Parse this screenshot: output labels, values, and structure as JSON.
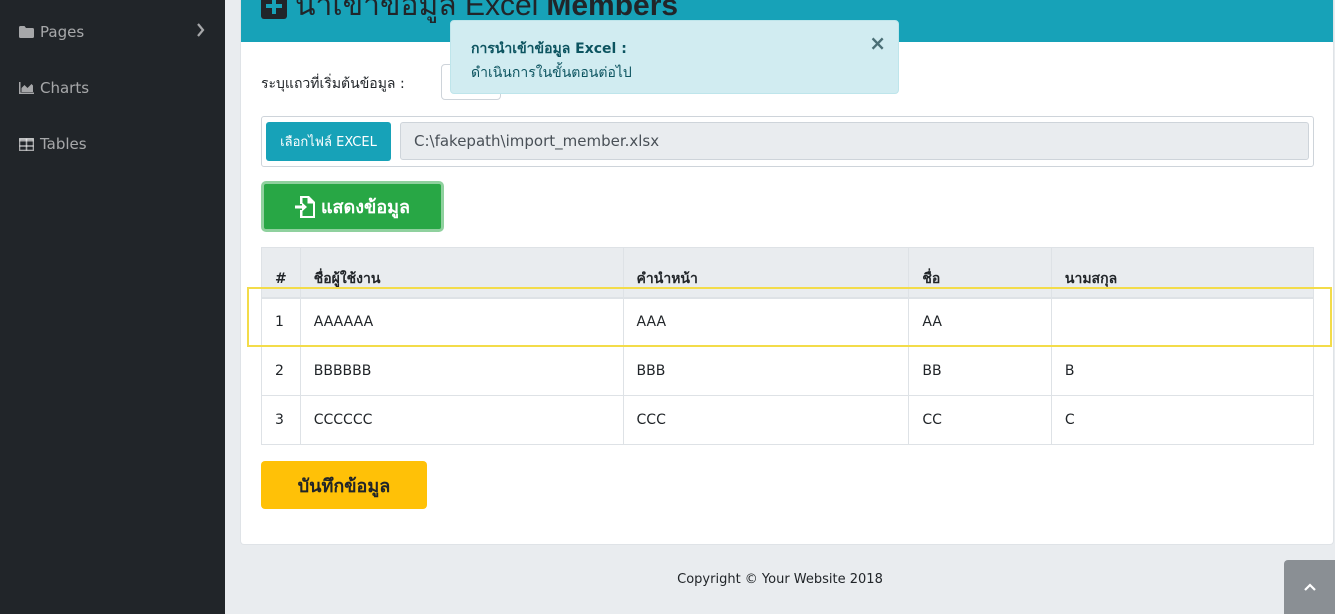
{
  "sidebar": {
    "items": [
      {
        "label": "Pages",
        "icon": "folder-icon"
      },
      {
        "label": "Charts",
        "icon": "area-chart-icon"
      },
      {
        "label": "Tables",
        "icon": "table-icon"
      }
    ]
  },
  "card": {
    "title_prefix": "นำเข้าข้อมูล Excel",
    "title_bold": "Members"
  },
  "form": {
    "start_row_label": "ระบุแถวที่เริ่มต้นข้อมูล :",
    "start_row_value": "",
    "file_button_label": "เลือกไฟล์ EXCEL",
    "file_path": "C:\\fakepath\\import_member.xlsx",
    "show_button_label": "แสดงข้อมูล",
    "save_button_label": "บันทึกข้อมูล"
  },
  "alert": {
    "title": "การนำเข้าข้อมูล Excel :",
    "text": "ดำเนินการในขั้นตอนต่อไป",
    "close": "×"
  },
  "table": {
    "headers": [
      "#",
      "ชื่อผู้ใช้งาน",
      "คำนำหน้า",
      "ชื่อ",
      "นามสกุล"
    ],
    "rows": [
      [
        "1",
        "AAAAAA",
        "AAA",
        "AA",
        ""
      ],
      [
        "2",
        "BBBBBB",
        "BBB",
        "BB",
        "B"
      ],
      [
        "3",
        "CCCCCC",
        "CCC",
        "CC",
        "C"
      ]
    ]
  },
  "footer": {
    "copyright": "Copyright © Your Website 2018"
  },
  "colors": {
    "header": "#17a2b8",
    "success": "#28a745",
    "warning": "#ffc107",
    "sidebar": "#212529",
    "highlight": "#f3dc4a"
  }
}
